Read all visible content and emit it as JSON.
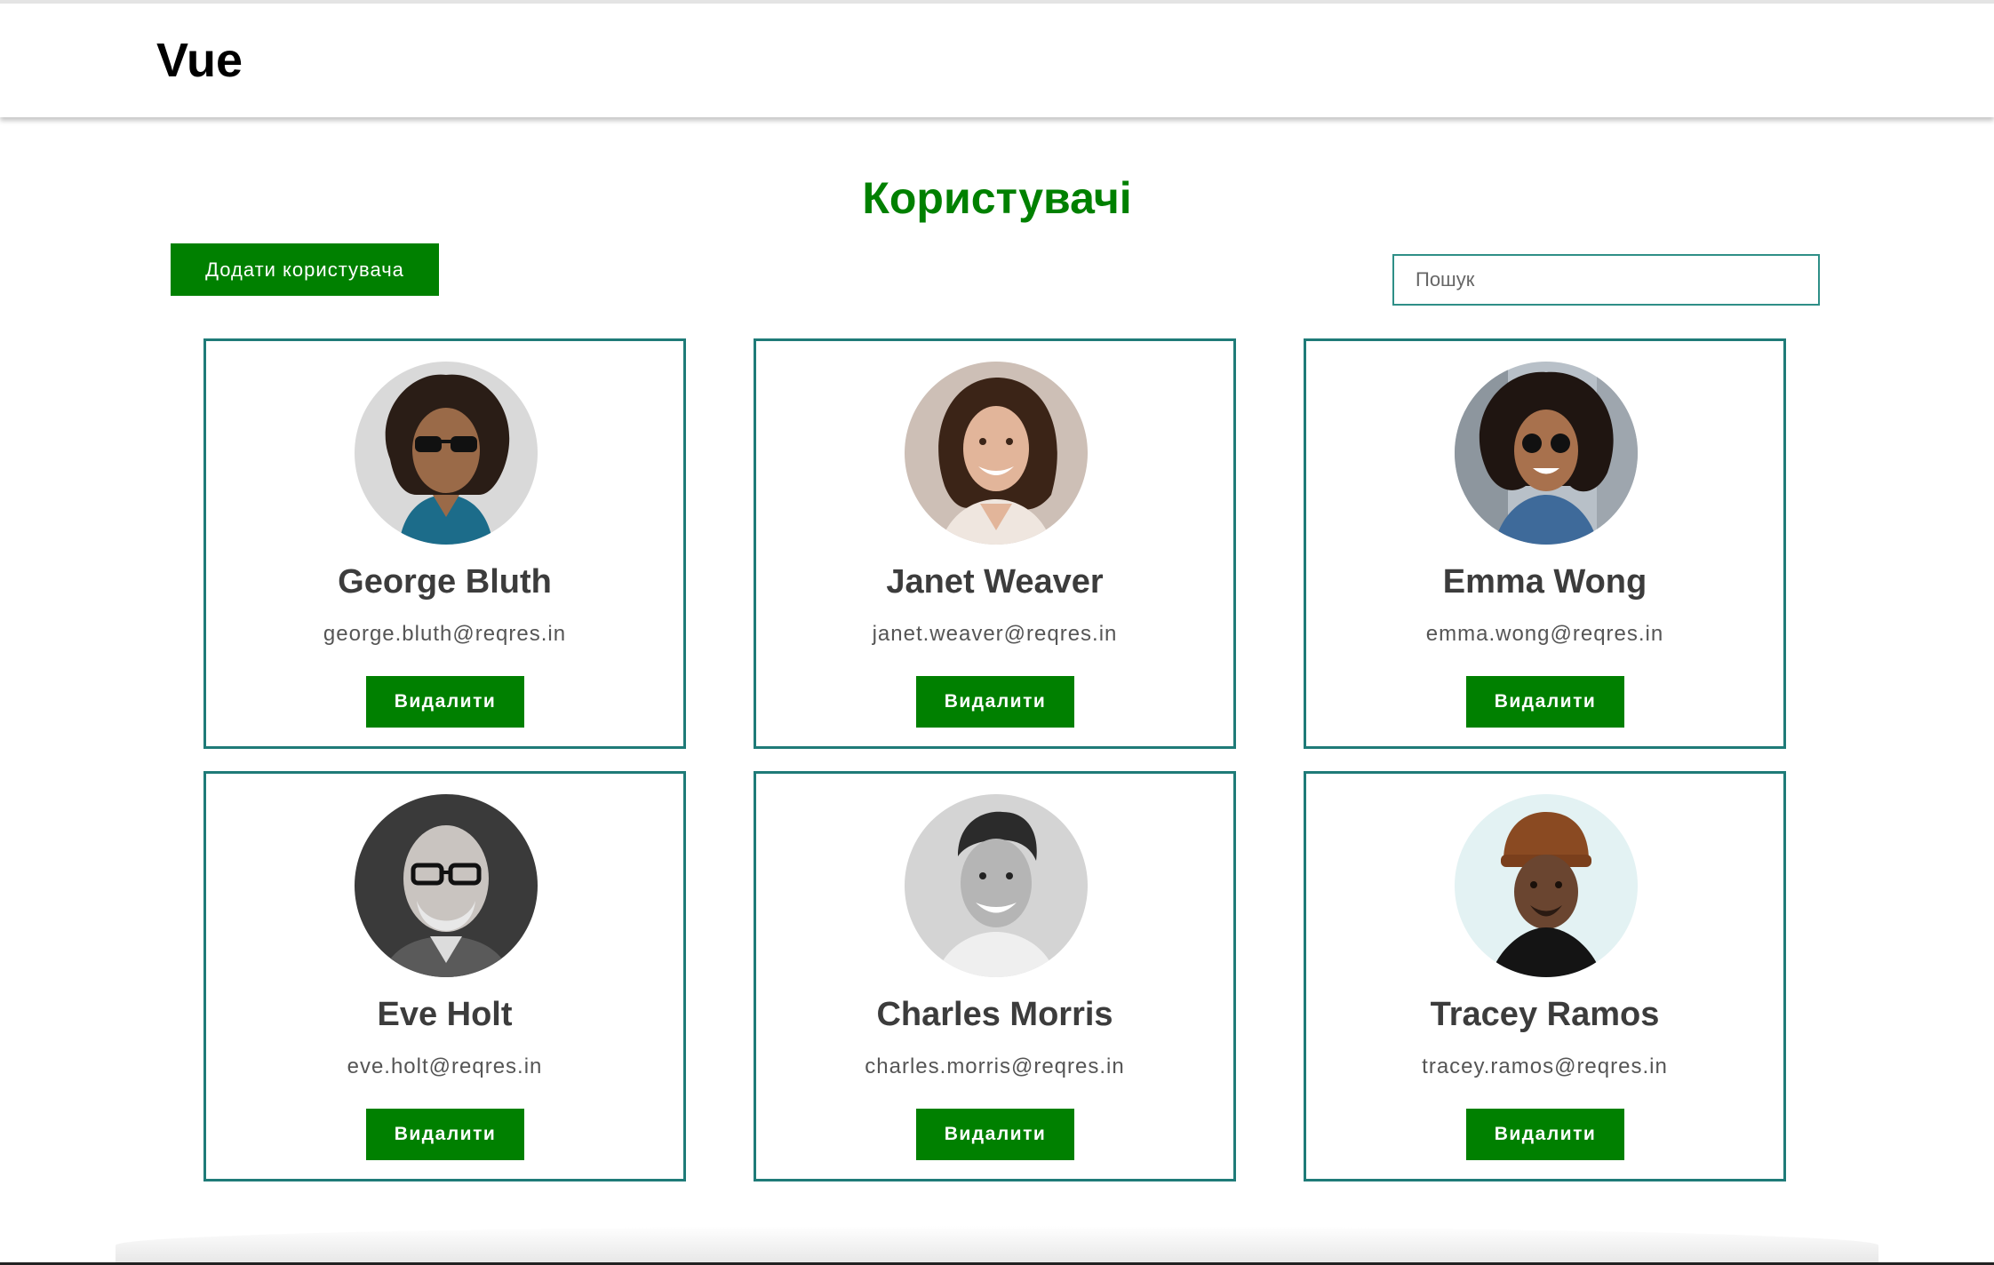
{
  "header": {
    "logo": "Vue"
  },
  "page": {
    "title": "Користувачі",
    "add_button_label": "Додати користувача",
    "search_placeholder": "Пошук",
    "search_value": ""
  },
  "users": [
    {
      "name": "George Bluth",
      "email": "george.bluth@reqres.in",
      "delete_label": "Видалити",
      "avatar_icon": "avatar-george-icon"
    },
    {
      "name": "Janet Weaver",
      "email": "janet.weaver@reqres.in",
      "delete_label": "Видалити",
      "avatar_icon": "avatar-janet-icon"
    },
    {
      "name": "Emma Wong",
      "email": "emma.wong@reqres.in",
      "delete_label": "Видалити",
      "avatar_icon": "avatar-emma-icon"
    },
    {
      "name": "Eve Holt",
      "email": "eve.holt@reqres.in",
      "delete_label": "Видалити",
      "avatar_icon": "avatar-eve-icon"
    },
    {
      "name": "Charles Morris",
      "email": "charles.morris@reqres.in",
      "delete_label": "Видалити",
      "avatar_icon": "avatar-charles-icon"
    },
    {
      "name": "Tracey Ramos",
      "email": "tracey.ramos@reqres.in",
      "delete_label": "Видалити",
      "avatar_icon": "avatar-tracey-icon"
    }
  ],
  "colors": {
    "accent_green": "#008000",
    "card_border": "#1f7b78",
    "search_border": "#2f8f87"
  }
}
